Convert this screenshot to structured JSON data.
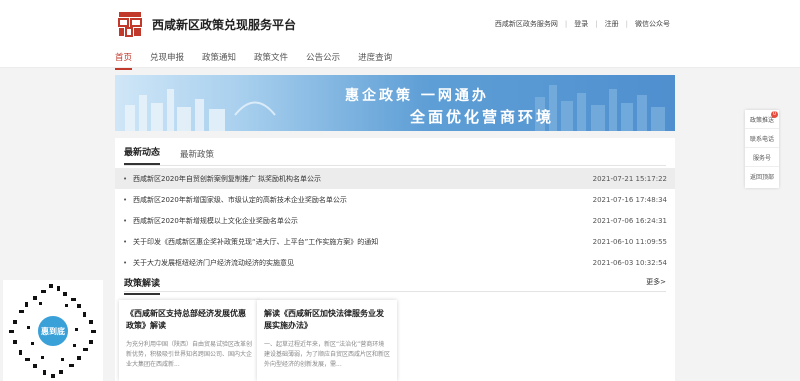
{
  "header": {
    "logo_icon": "seal-logo-icon",
    "site_title": "西咸新区政策兑现服务平台",
    "links": [
      "西咸新区政务服务网",
      "登录",
      "注册",
      "微信公众号"
    ]
  },
  "nav": {
    "items": [
      "首页",
      "兑现申报",
      "政策通知",
      "政策文件",
      "公告公示",
      "进度查询"
    ]
  },
  "banner": {
    "line1": "惠企政策 一网通办",
    "line2": "全面优化营商环境"
  },
  "tabs": [
    "最新动态",
    "最新政策"
  ],
  "news": [
    {
      "title": "西咸新区2020年自贸创新案例复制推广 拟奖励机构名单公示",
      "date": "2021-07-21 15:17:22"
    },
    {
      "title": "西咸新区2020年新增国家级、市级认定的高新技术企业奖励名单公示",
      "date": "2021-07-16 17:48:34"
    },
    {
      "title": "西咸新区2020年新增规模以上文化企业奖励名单公示",
      "date": "2021-07-06 16:24:31"
    },
    {
      "title": "关于印发《西咸新区惠企奖补政策兑现“进大厅、上平台”工作实施方案》的通知",
      "date": "2021-06-10 11:09:55"
    },
    {
      "title": "关于大力发展枢纽经济门户经济流动经济的实施意见",
      "date": "2021-06-03 10:32:54"
    }
  ],
  "policy_section": {
    "title": "政策解读",
    "more": "更多>"
  },
  "cards": [
    {
      "title": "《西咸新区支持总部经济发展优惠政策》解读",
      "text": "为充分利用中国（陕西）自由贸易试验区改革创新优势，积极吸引世界知名跨国公司、国内大企业大集团在西咸新..."
    },
    {
      "title": "解读《西咸新区加快法律服务业发展实施办法》",
      "text": "一、起草过程近年来，新区“法治化”营商环境建设基础薄弱，为了顺应自贸区西咸片区和新区外向型经济的创新发展，需..."
    }
  ],
  "sidebar": {
    "items": [
      "政策推送",
      "联系电话",
      "服务号",
      "返回顶部"
    ],
    "badge": "0"
  },
  "qr": {
    "label": "惠到底"
  },
  "colors": {
    "accent": "#c0392b",
    "banner_blue": "#4f8fcf"
  }
}
